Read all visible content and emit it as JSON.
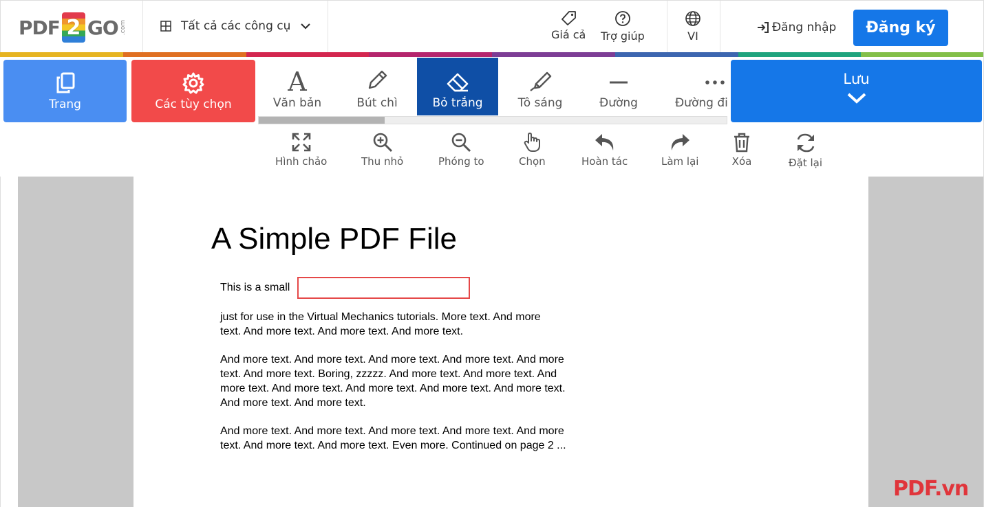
{
  "header": {
    "logo_pdf": "PDF",
    "logo_2": "2",
    "logo_go": "GO",
    "logo_com": ".com",
    "all_tools": "Tất cả các công cụ",
    "price": "Giá cả",
    "help": "Trợ giúp",
    "language": "VI",
    "login": "Đăng nhập",
    "signup": "Đăng ký"
  },
  "rainbow_colors": [
    "#e6b422",
    "#e06f21",
    "#d3264f",
    "#b5256d",
    "#7d3d95",
    "#3c66b0",
    "#1ea37e",
    "#82bf49"
  ],
  "toolbar": {
    "pages": "Trang",
    "options": "Các tùy chọn",
    "text": "Văn bản",
    "pencil": "Bút chì",
    "whiteout": "Bỏ trắng",
    "highlight": "Tô sáng",
    "line": "Đường",
    "more": "Đường đi",
    "save": "Lưu"
  },
  "subtoolbar": {
    "pan": "Hình chảo",
    "zoom_out": "Thu nhỏ",
    "zoom_in": "Phóng to",
    "select": "Chọn",
    "undo": "Hoàn tác",
    "redo": "Làm lại",
    "delete": "Xóa",
    "reset": "Đặt lại"
  },
  "document": {
    "title": "A Simple PDF File",
    "line1": "This is a small",
    "para1": "just for use in the Virtual Mechanics tutorials. More text. And more\ntext. And more text. And more text. And more text.",
    "para2": "And more text. And more text. And more text. And more text. And more\ntext. And more text. Boring, zzzzz. And more text. And more text. And\nmore text. And more text. And more text. And more text. And more text.\nAnd more text. And more text.",
    "para3": "And more text. And more text. And more text. And more text. And more\ntext. And more text. And more text. Even more. Continued on page 2 ..."
  },
  "watermark": "PDF.vn",
  "colors": {
    "primary_blue": "#1577e8",
    "pages_blue": "#4a8ef2",
    "options_red": "#f24a4a",
    "active_tool": "#0f4fa6",
    "whiteout_border": "#e54848"
  }
}
